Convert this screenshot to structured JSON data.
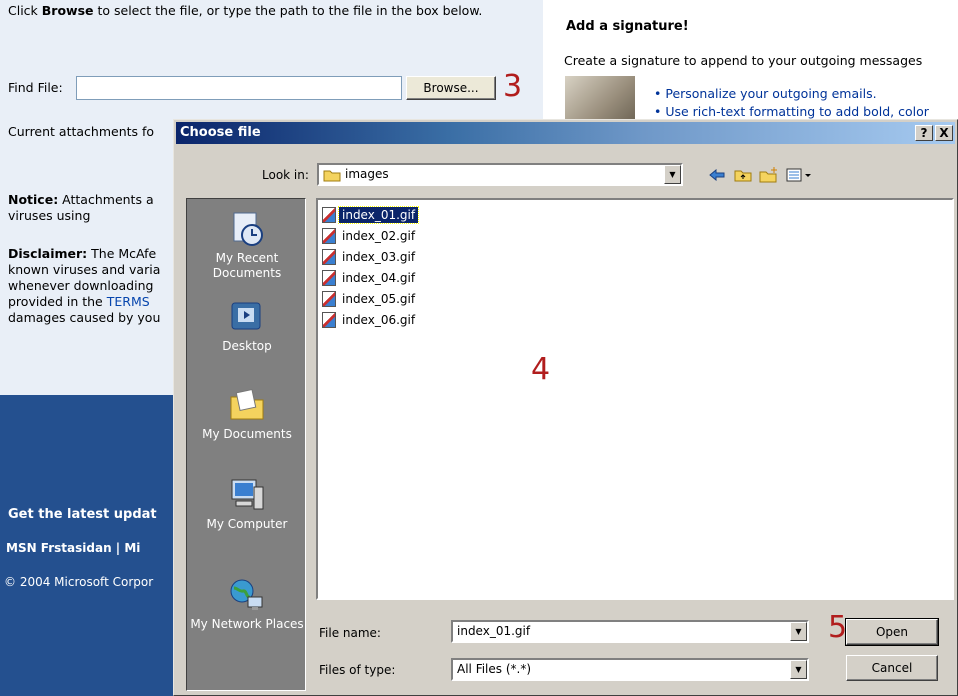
{
  "background_page": {
    "intro_text": "Click Browse to select the file, or type the path to the file in the box below.",
    "intro_bold": "Browse",
    "find_file_label": "Find File:",
    "browse_button": "Browse...",
    "current_attachments": "Current attachments fo",
    "notice_bold": "Notice:",
    "notice_text": " Attachments a",
    "notice_line2": "viruses using",
    "disclaimer_bold": "Disclaimer:",
    "disclaimer_line1": " The McAfe",
    "disclaimer_line2": "known viruses and varia",
    "disclaimer_line3": "whenever downloading",
    "disclaimer_line4_pre": "provided in the ",
    "disclaimer_line4_link": "TERMS",
    "disclaimer_line5": "damages caused by you",
    "footer_updates": "Get the latest updat",
    "footer_links": "MSN Frstasidan | Mi",
    "footer_copyright": "© 2004 Microsoft Corpor",
    "signature_title": "Add a signature!",
    "signature_subtitle": "Create a signature to append to your outgoing messages",
    "signature_bullets": [
      "• Personalize your outgoing emails.",
      "• Use rich-text formatting to add bold, color"
    ]
  },
  "callouts": {
    "step3": "3",
    "step4": "4",
    "step5": "5"
  },
  "dialog": {
    "title": "Choose file",
    "help_button": "?",
    "close_button": "X",
    "look_in_label": "Look in:",
    "look_in_value": "images",
    "places": [
      {
        "label": "My Recent Documents"
      },
      {
        "label": "Desktop"
      },
      {
        "label": "My Documents"
      },
      {
        "label": "My Computer"
      },
      {
        "label": "My Network Places"
      }
    ],
    "files": [
      "index_01.gif",
      "index_02.gif",
      "index_03.gif",
      "index_04.gif",
      "index_05.gif",
      "index_06.gif"
    ],
    "selected_file": "index_01.gif",
    "file_name_label": "File name:",
    "file_name_value": "index_01.gif",
    "files_of_type_label": "Files of type:",
    "files_of_type_value": "All Files (*.*)",
    "open_button": "Open",
    "cancel_button": "Cancel"
  },
  "colors": {
    "callout": "#b11d1d",
    "title_bar": "#0a246a",
    "footer_bg": "#24508f",
    "selection": "#0a246a"
  }
}
